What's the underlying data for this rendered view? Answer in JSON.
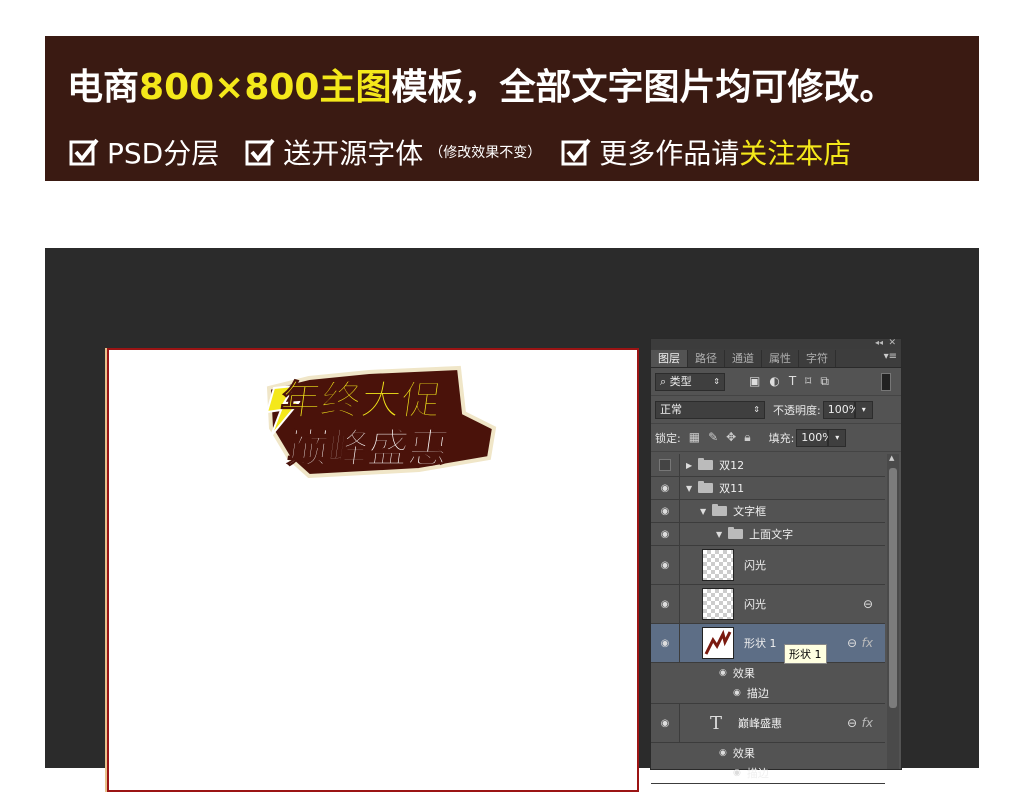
{
  "banner": {
    "line1_a": "电商",
    "line1_b": "800×800主图",
    "line1_c": "模板，全部文字图片均可修改。",
    "feature1": "PSD分层",
    "feature2": "送开源字体",
    "feature2_note": "（修改效果不变）",
    "feature3_a": "更多作品请",
    "feature3_b": "关注本店",
    "bg_color": "#3a1a12",
    "highlight_color": "#f4e81a"
  },
  "canvas": {
    "title_line1": "年终大促",
    "title_line2": "巅峰盛惠"
  },
  "panel": {
    "tabs": [
      "图层",
      "路径",
      "通道",
      "属性",
      "字符"
    ],
    "filter_label": "类型",
    "blend_mode": "正常",
    "opacity_label": "不透明度:",
    "opacity_value": "100%",
    "lock_label": "锁定:",
    "fill_label": "填充:",
    "fill_value": "100%",
    "layers": {
      "g1": "双12",
      "g2": "双11",
      "g3": "文字框",
      "g4": "上面文字",
      "l1": "闪光",
      "l2": "闪光",
      "l3": "形状 1",
      "l3_effects": "效果",
      "l3_stroke": "描边",
      "l4": "巅峰盛惠",
      "l4_effects": "效果",
      "l4_stroke": "描边"
    },
    "tooltip": "形状 1"
  }
}
